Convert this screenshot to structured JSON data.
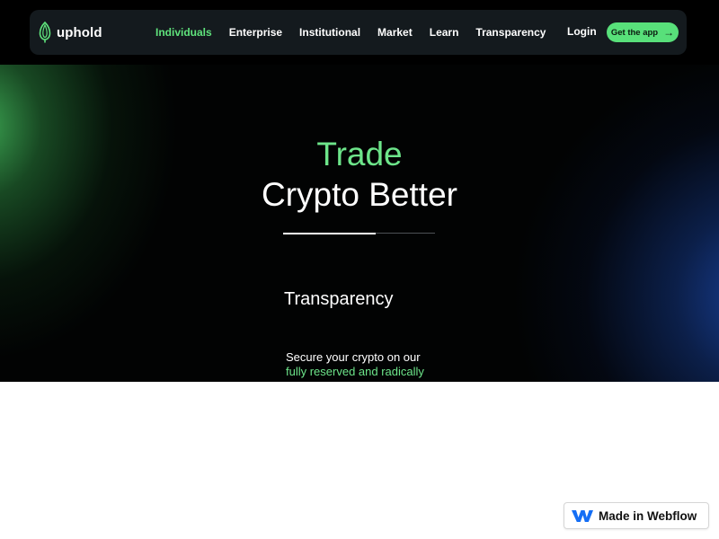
{
  "brand": {
    "name": "uphold",
    "accent_color": "#5fe37c"
  },
  "nav": {
    "links": [
      {
        "label": "Individuals",
        "active": true
      },
      {
        "label": "Enterprise",
        "active": false
      },
      {
        "label": "Institutional",
        "active": false
      },
      {
        "label": "Market",
        "active": false
      },
      {
        "label": "Learn",
        "active": false
      },
      {
        "label": "Transparency",
        "active": false
      }
    ],
    "login_label": "Login",
    "cta_label": "Get the app"
  },
  "hero": {
    "headline_line1": "Trade",
    "headline_line2": "Crypto Better",
    "slide_progress": 0.61,
    "slide_title": "Transparency",
    "slide_description_line1": "Secure your crypto on our",
    "slide_description_line2": "fully reserved and radically"
  },
  "badge": {
    "label": "Made in Webflow",
    "icon": "webflow-icon",
    "color": "#146ef5"
  }
}
